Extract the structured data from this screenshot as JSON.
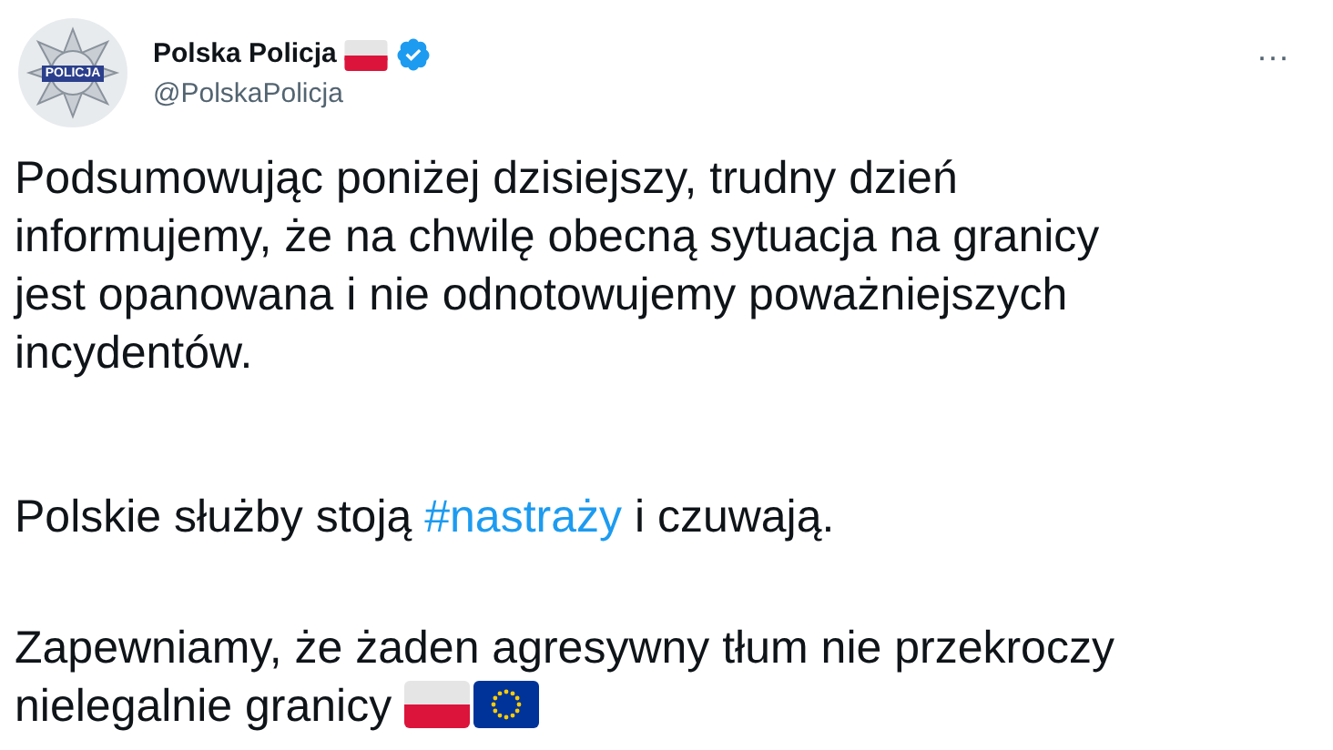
{
  "author": {
    "name": "Polska Policja",
    "handle": "@PolskaPolicja",
    "verified": true,
    "avatar_label": "POLICJA"
  },
  "more_button": "···",
  "paragraphs": [
    {
      "lines": [
        [
          {
            "kind": "text",
            "text": "Podsumowując poniżej dzisiejszy, trudny dzień"
          }
        ],
        [
          {
            "kind": "text",
            "text": "informujemy, że na chwilę obecną sytuacja na granicy"
          }
        ],
        [
          {
            "kind": "text",
            "text": "jest opanowana i nie odnotowujemy poważniejszych"
          }
        ],
        [
          {
            "kind": "text",
            "text": "incydentów."
          }
        ]
      ]
    },
    {
      "lines": [
        [
          {
            "kind": "text",
            "text": "Polskie służby stoją "
          },
          {
            "kind": "hashtag",
            "text": "#nastraży"
          },
          {
            "kind": "text",
            "text": " i czuwają."
          }
        ]
      ]
    },
    {
      "lines": [
        [
          {
            "kind": "text",
            "text": "Zapewniamy, że żaden agresywny tłum nie przekroczy"
          }
        ],
        [
          {
            "kind": "text",
            "text": "nielegalnie granicy "
          },
          {
            "kind": "flag_pl"
          },
          {
            "kind": "flag_eu"
          }
        ]
      ]
    }
  ]
}
